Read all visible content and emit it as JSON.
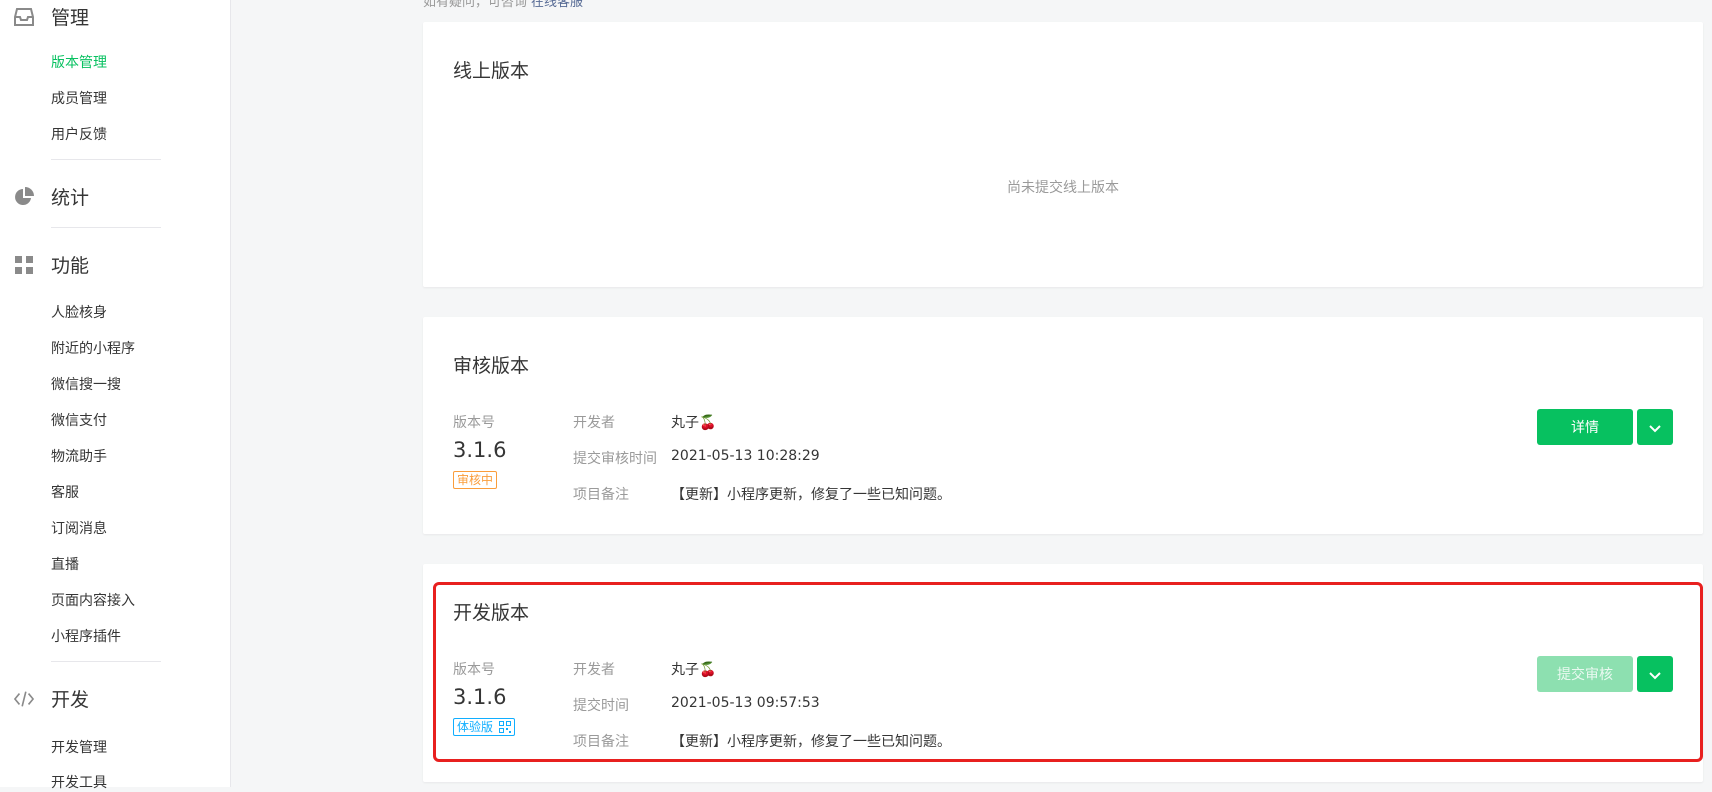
{
  "sidebar": {
    "management": {
      "title": "管理",
      "icon": "inbox-icon",
      "items": [
        {
          "label": "版本管理",
          "active": true
        },
        {
          "label": "成员管理",
          "active": false
        },
        {
          "label": "用户反馈",
          "active": false
        }
      ]
    },
    "statistics": {
      "title": "统计",
      "icon": "pie-chart-icon"
    },
    "features": {
      "title": "功能",
      "icon": "grid-icon",
      "items": [
        {
          "label": "人脸核身"
        },
        {
          "label": "附近的小程序"
        },
        {
          "label": "微信搜一搜"
        },
        {
          "label": "微信支付"
        },
        {
          "label": "物流助手"
        },
        {
          "label": "客服"
        },
        {
          "label": "订阅消息"
        },
        {
          "label": "直播"
        },
        {
          "label": "页面内容接入"
        },
        {
          "label": "小程序插件"
        }
      ]
    },
    "development": {
      "title": "开发",
      "icon": "code-icon",
      "items": [
        {
          "label": "开发管理"
        },
        {
          "label": "开发工具"
        }
      ]
    }
  },
  "hint": {
    "text": "如有疑问，可咨询",
    "link": "在线客服"
  },
  "online_card": {
    "title": "线上版本",
    "empty_text": "尚未提交线上版本"
  },
  "review_card": {
    "title": "审核版本",
    "version_label": "版本号",
    "version": "3.1.6",
    "status_badge": "审核中",
    "developer_label": "开发者",
    "developer": "丸子🍒",
    "time_label": "提交审核时间",
    "time": "2021-05-13 10:28:29",
    "note_label": "项目备注",
    "note": "【更新】小程序更新，修复了一些已知问题。",
    "primary_button": "详情"
  },
  "dev_card": {
    "title": "开发版本",
    "version_label": "版本号",
    "version": "3.1.6",
    "status_badge": "体验版",
    "developer_label": "开发者",
    "developer": "丸子🍒",
    "time_label": "提交时间",
    "time": "2021-05-13 09:57:53",
    "note_label": "项目备注",
    "note": "【更新】小程序更新，修复了一些已知问题。",
    "primary_button": "提交审核"
  },
  "colors": {
    "accent": "#07c160",
    "accent_disabled": "#8de0b0",
    "review_badge": "#fa9d3b",
    "experience_badge": "#10aeff",
    "highlight": "#e8201f"
  }
}
